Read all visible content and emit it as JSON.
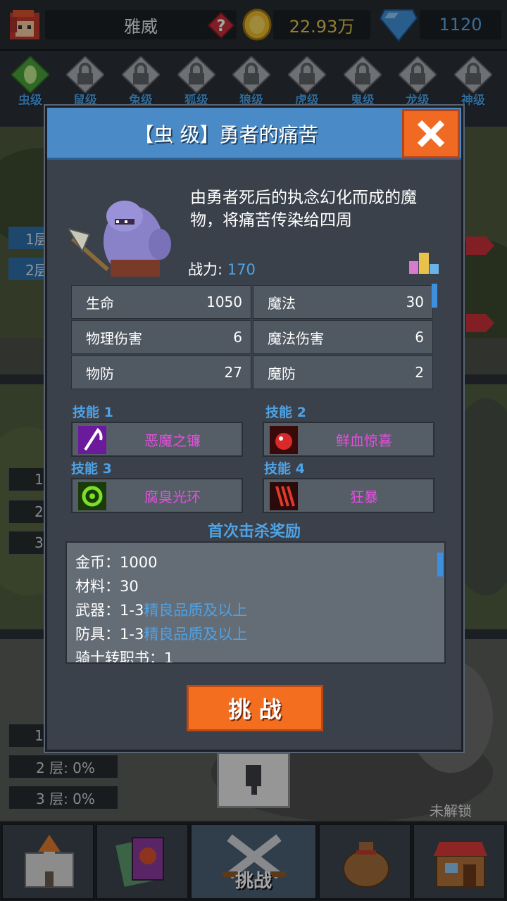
{
  "header": {
    "player_name": "雅威",
    "gold": "22.93万",
    "gems": "1120"
  },
  "tiers": [
    {
      "label": "虫级",
      "locked": false
    },
    {
      "label": "鼠级",
      "locked": true
    },
    {
      "label": "兔级",
      "locked": true
    },
    {
      "label": "狐级",
      "locked": true
    },
    {
      "label": "狼级",
      "locked": true
    },
    {
      "label": "虎级",
      "locked": true
    },
    {
      "label": "鬼级",
      "locked": true
    },
    {
      "label": "龙级",
      "locked": true
    },
    {
      "label": "神级",
      "locked": true
    }
  ],
  "background": {
    "section1_tags": [
      "1层",
      "2层"
    ],
    "section2_tags": [
      "1",
      "2",
      "3"
    ],
    "section3_tags": [
      "1",
      "2 层: 0%",
      "3 层: 0%"
    ],
    "locked_label": "未解锁"
  },
  "modal": {
    "title": "【虫 级】勇者的痛苦",
    "description": "由勇者死后的执念幻化而成的魔物，将痛苦传染给四周",
    "power_label": "战力:",
    "power_value": "170",
    "stats": [
      {
        "label": "生命",
        "value": "1050"
      },
      {
        "label": "魔法",
        "value": "30"
      },
      {
        "label": "物理伤害",
        "value": "6"
      },
      {
        "label": "魔法伤害",
        "value": "6"
      },
      {
        "label": "物防",
        "value": "27"
      },
      {
        "label": "魔防",
        "value": "2"
      }
    ],
    "skills": [
      {
        "title": "技能 1",
        "name": "恶魔之镰"
      },
      {
        "title": "技能 2",
        "name": "鲜血惊喜"
      },
      {
        "title": "技能 3",
        "name": "腐臭光环"
      },
      {
        "title": "技能 4",
        "name": "狂暴"
      }
    ],
    "reward_title": "首次击杀奖励",
    "rewards": [
      {
        "prefix": "金币：1000",
        "highlight": ""
      },
      {
        "prefix": "材料：30",
        "highlight": ""
      },
      {
        "prefix": "武器：1-3",
        "highlight": "精良品质及以上"
      },
      {
        "prefix": "防具：1-3",
        "highlight": "精良品质及以上"
      },
      {
        "prefix": "骑士转职书：1",
        "highlight": ""
      }
    ],
    "challenge_label": "挑 战"
  },
  "bottom_nav": {
    "active_label": "挑战"
  },
  "colors": {
    "accent_blue": "#4ea3e6",
    "skill_pink": "#e64ee0",
    "orange": "#f36f1f",
    "gold": "#e2c34b"
  }
}
